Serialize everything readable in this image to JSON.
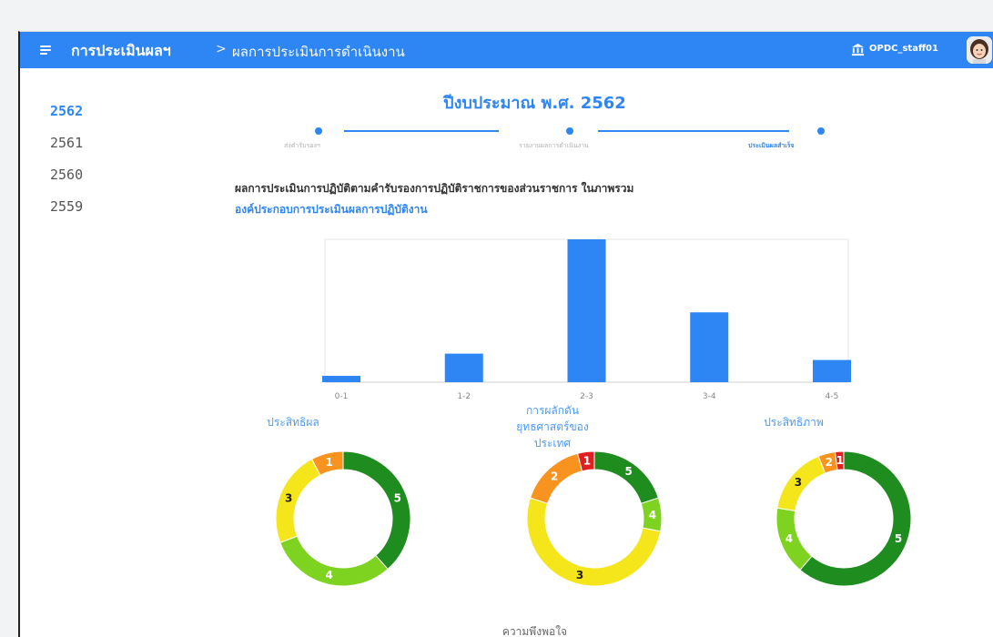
{
  "header": {
    "app_title": "การประเมินผลฯ",
    "separator": ">",
    "page_title": "ผลการประเมินการดำเนินงาน",
    "user_name": "OPDC_staff01",
    "bar_color": "#2e86f5"
  },
  "sidebar": {
    "years": [
      {
        "label": "2562",
        "active": true
      },
      {
        "label": "2561",
        "active": false
      },
      {
        "label": "2560",
        "active": false
      },
      {
        "label": "2559",
        "active": false
      }
    ]
  },
  "main": {
    "budget_title": "ปีงบประมาณ พ.ศ. 2562",
    "stepper": {
      "steps": [
        {
          "label": "ส่งคำรับรองฯ",
          "status": "done"
        },
        {
          "label": "รายงานผลการดำเนินงาน",
          "status": "done"
        },
        {
          "label": "ประเมินผลสำเร็จ",
          "status": "current"
        }
      ]
    },
    "section_heading": "ผลการประเมินการปฏิบัติตามคำรับรองการปฏิบัติราชการของส่วนราชการ ในภาพรวม",
    "section_link": "องค์ประกอบการประเมินผลการปฏิบัติงาน",
    "next_heading": "ความพึงพอใจ"
  },
  "chart_data": [
    {
      "type": "bar",
      "categories": [
        "0-1",
        "1-2",
        "2-3",
        "3-4",
        "4-5"
      ],
      "values": [
        2,
        9,
        45,
        22,
        7
      ],
      "ylim": [
        0,
        45
      ],
      "grid": false,
      "color": "#2e86f5"
    },
    {
      "type": "pie",
      "title": "ประสิทธิผล",
      "labels": [
        "5",
        "4",
        "3",
        "1"
      ],
      "values": [
        5,
        4,
        3,
        1
      ],
      "colors": [
        "#1e8c1e",
        "#7ed321",
        "#f5e51b",
        "#f7931e"
      ]
    },
    {
      "type": "pie",
      "title": "การผลักดันยุทธศาสตร์ของประเทศ",
      "labels": [
        "5",
        "4",
        "3",
        "2",
        "1"
      ],
      "values": [
        5,
        2,
        13,
        4,
        1
      ],
      "colors": [
        "#1e8c1e",
        "#7ed321",
        "#f5e51b",
        "#f7931e",
        "#e02020"
      ]
    },
    {
      "type": "pie",
      "title": "ประสิทธิภาพ",
      "labels": [
        "5",
        "4",
        "3",
        "2",
        "1"
      ],
      "values": [
        15,
        4,
        4,
        1,
        0.5
      ],
      "colors": [
        "#1e8c1e",
        "#7ed321",
        "#f5e51b",
        "#f7931e",
        "#e02020"
      ]
    }
  ]
}
